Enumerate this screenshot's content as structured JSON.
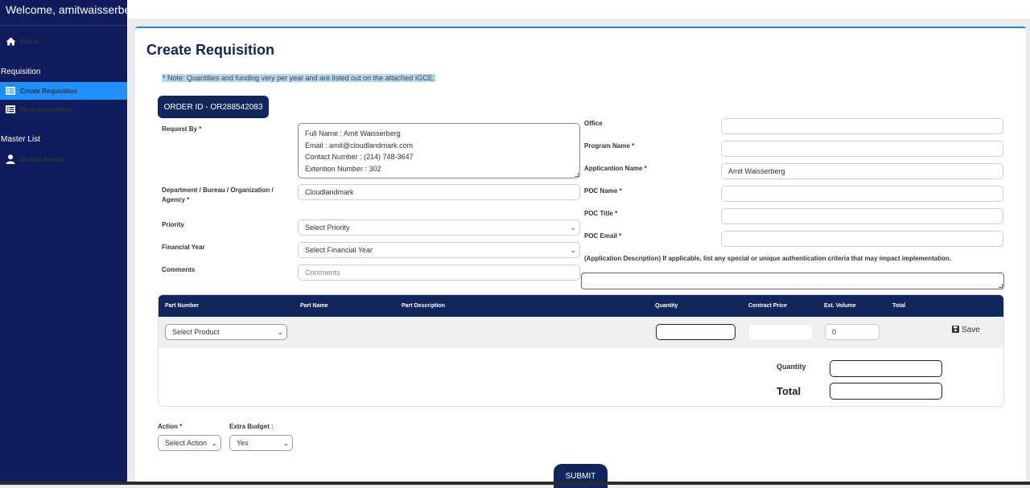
{
  "sidebar": {
    "welcome": "Welcome, amitwaisserbe",
    "home": "Home",
    "section_requisition": "Requisition",
    "create_requisition": "Create Requisition",
    "view_requisition": "View Requisition",
    "section_master": "Master List",
    "update_profile": "Update Profile"
  },
  "page": {
    "title": "Create Requisition",
    "note": "* Note: Quantities and funding very per year and are listed out on the attached IGCE.",
    "order_id": "ORDER ID - OR288542083"
  },
  "form": {
    "request_by_label": "Request By *",
    "request_by_lines": [
      "Full Name : Amit Waisserberg",
      "Email : amit@cloudlandmark.com",
      "Contact Number : (214) 748-3647",
      "Extention Number : 302"
    ],
    "department_label": "Department / Bureau / Organization / Agency *",
    "department_value": "Cloudlandmark",
    "priority_label": "Priority",
    "priority_value": "Select Priority",
    "financial_year_label": "Financial Year",
    "financial_year_value": "Select Financial Year",
    "comments_label": "Comments",
    "comments_placeholder": "Comments",
    "office_label": "Office",
    "program_name_label": "Program Name *",
    "application_name_label": "Applicantion Name *",
    "application_name_value": "Amit Waisserberg",
    "poc_name_label": "POC Name *",
    "poc_title_label": "POC Title *",
    "poc_email_label": "POC Email *",
    "app_description_label": "(Application Description) If applicable, list any special or unique authentication criteria that may impact implementation."
  },
  "table": {
    "headers": [
      "Part Number",
      "Part Name",
      "Part Description",
      "Quantity",
      "Contract Price",
      "Est. Volume",
      "Total"
    ],
    "product_select": "Select Product",
    "est_volume_value": "0",
    "save_label": "Save",
    "quantity_label": "Quantity",
    "total_label": "Total"
  },
  "footer": {
    "action_label": "Action *",
    "action_value": "Select Action",
    "extra_budget_label": "Extra Budget :",
    "extra_budget_value": "Yes",
    "submit_label": "SUBMIT"
  },
  "colors": {
    "sidebar_bg": "#0f1d5c",
    "active_item": "#1e90ff",
    "primary": "#12265e"
  },
  "icons": {
    "home": "home-icon",
    "create": "list-icon",
    "view": "list-icon",
    "profile": "user-icon",
    "save": "floppy-icon"
  }
}
